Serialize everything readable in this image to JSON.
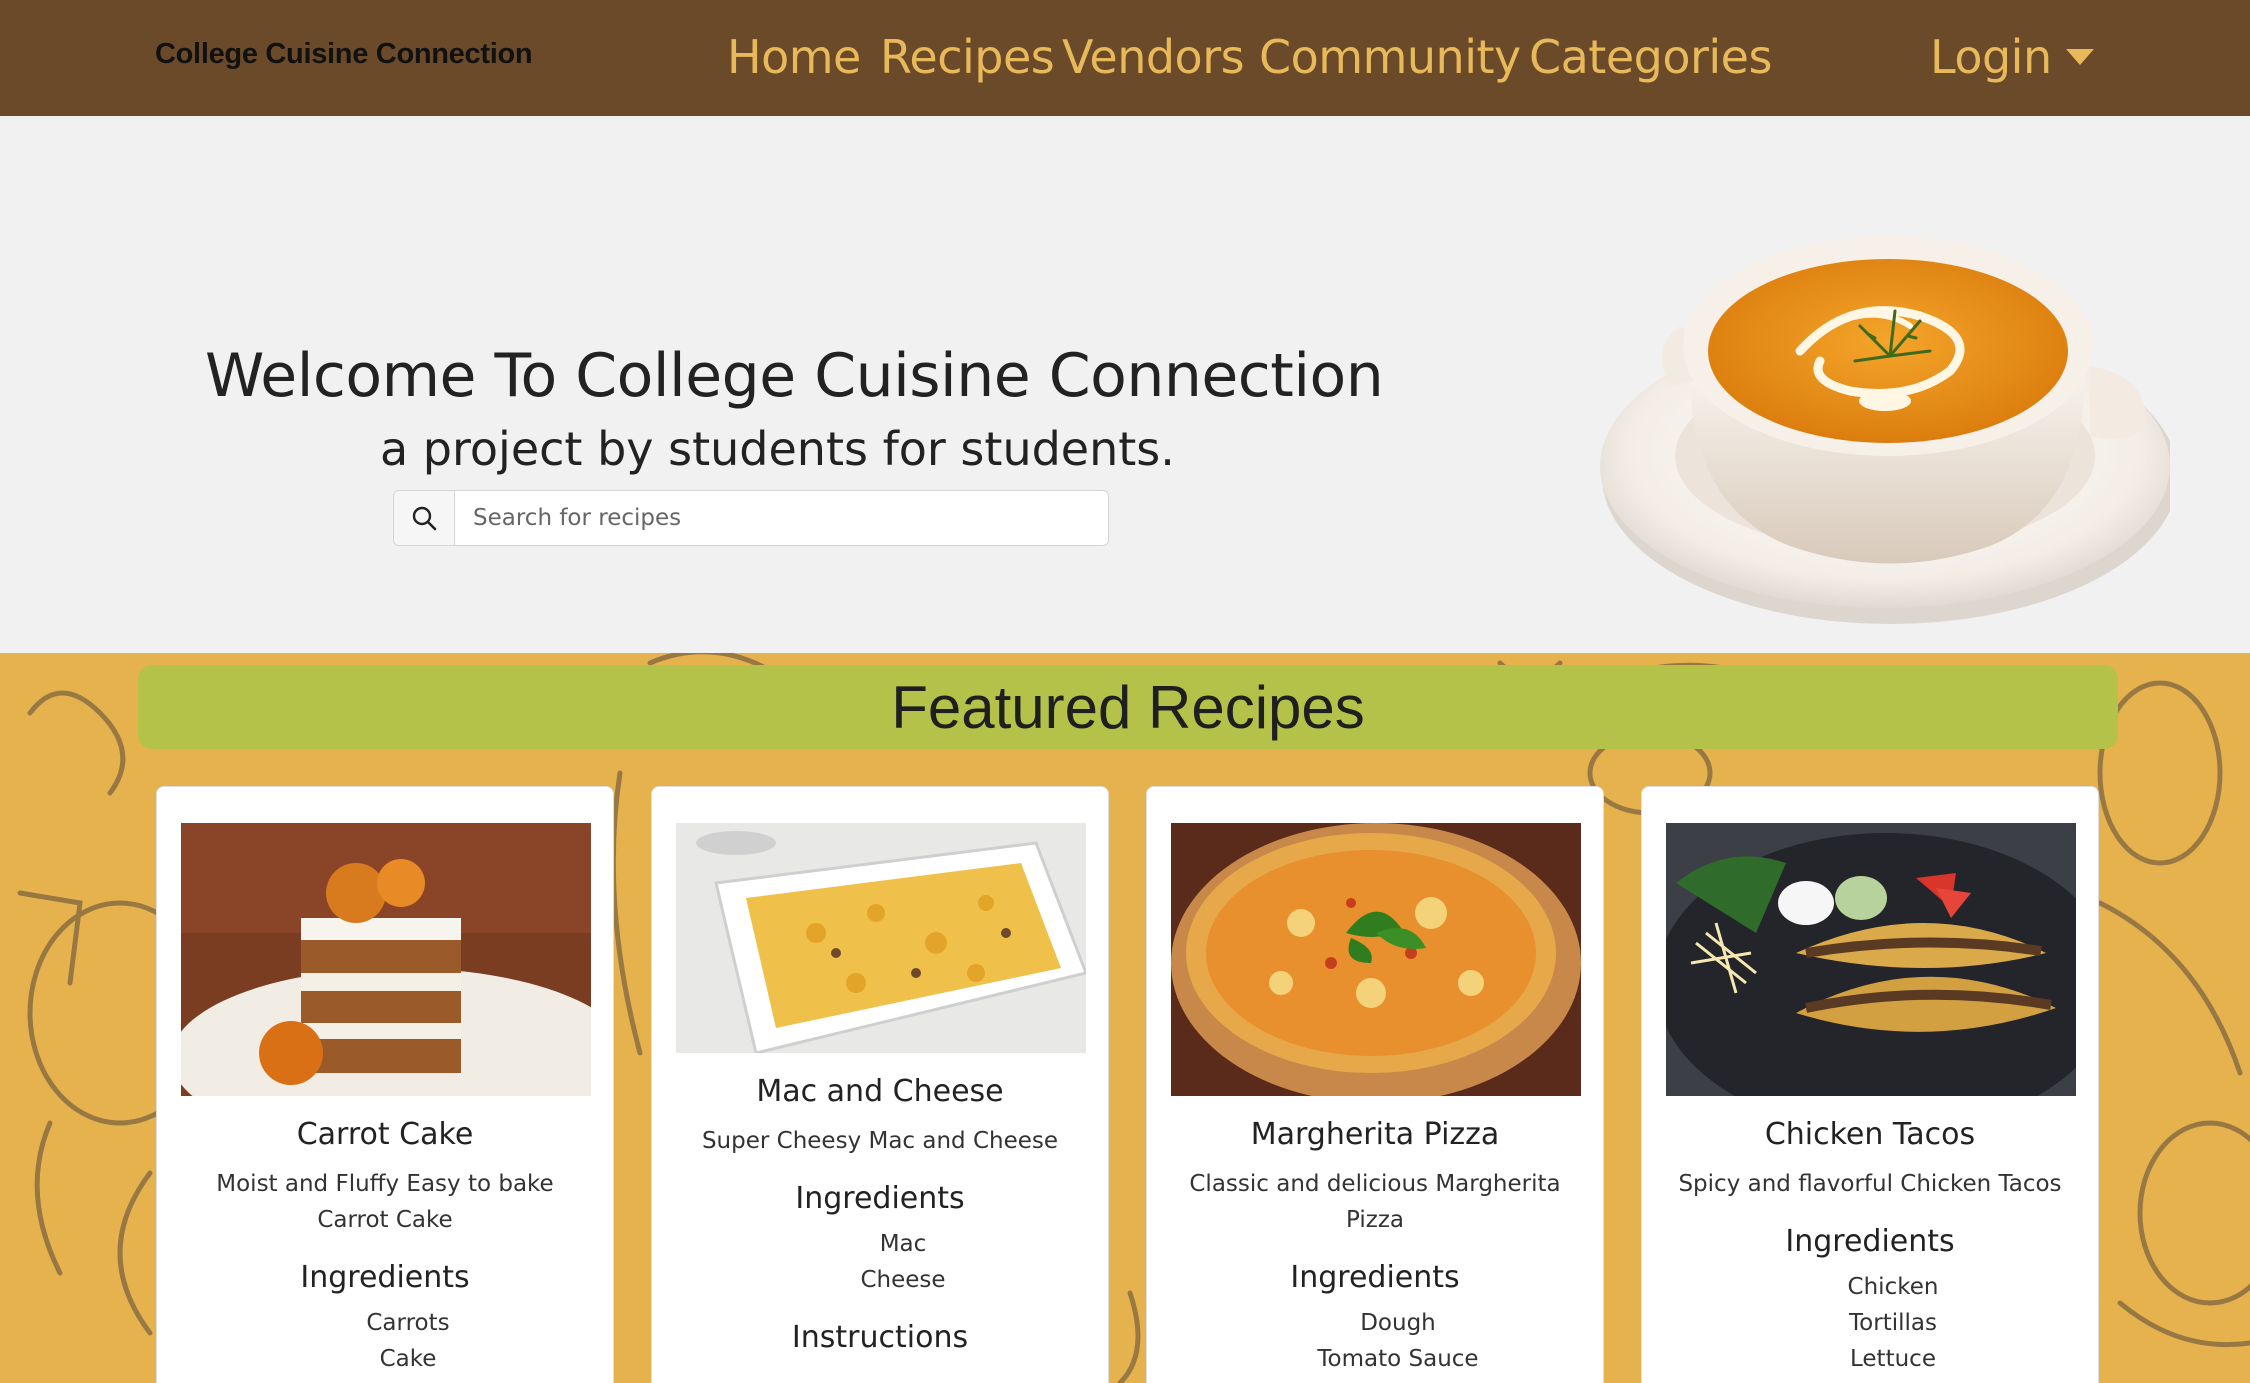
{
  "navbar": {
    "brand": "College Cuisine Connection",
    "links": [
      "Home",
      "Recipes",
      "Vendors",
      "Community",
      "Categories"
    ],
    "login": "Login",
    "bg_color": "#6b4a2a",
    "link_color": "#e8b95a"
  },
  "hero": {
    "title": "Welcome To College Cuisine Connection",
    "subtitle": "a project by students for students.",
    "search": {
      "placeholder": "Search for recipes",
      "icon": "search-icon"
    },
    "image": "soup-bowl-image"
  },
  "featured": {
    "heading": "Featured Recipes",
    "banner_color": "#b5c24a",
    "bg_color": "#e6b24e",
    "recipes": [
      {
        "title": "Carrot Cake",
        "description": "Moist and Fluffy Easy to bake Carrot Cake",
        "ingredients_label": "Ingredients",
        "ingredients": [
          "Carrots",
          "Cake"
        ],
        "image": "carrot-cake-image"
      },
      {
        "title": "Mac and Cheese",
        "description": "Super Cheesy Mac and Cheese",
        "ingredients_label": "Ingredients",
        "ingredients": [
          "Mac",
          "Cheese"
        ],
        "instructions_label": "Instructions",
        "image": "mac-and-cheese-image"
      },
      {
        "title": "Margherita Pizza",
        "description": "Classic and delicious Margherita Pizza",
        "ingredients_label": "Ingredients",
        "ingredients": [
          "Dough",
          "Tomato Sauce"
        ],
        "image": "pizza-image"
      },
      {
        "title": "Chicken Tacos",
        "description": "Spicy and flavorful Chicken Tacos",
        "ingredients_label": "Ingredients",
        "ingredients": [
          "Chicken",
          "Tortillas",
          "Lettuce"
        ],
        "image": "tacos-image"
      }
    ]
  }
}
